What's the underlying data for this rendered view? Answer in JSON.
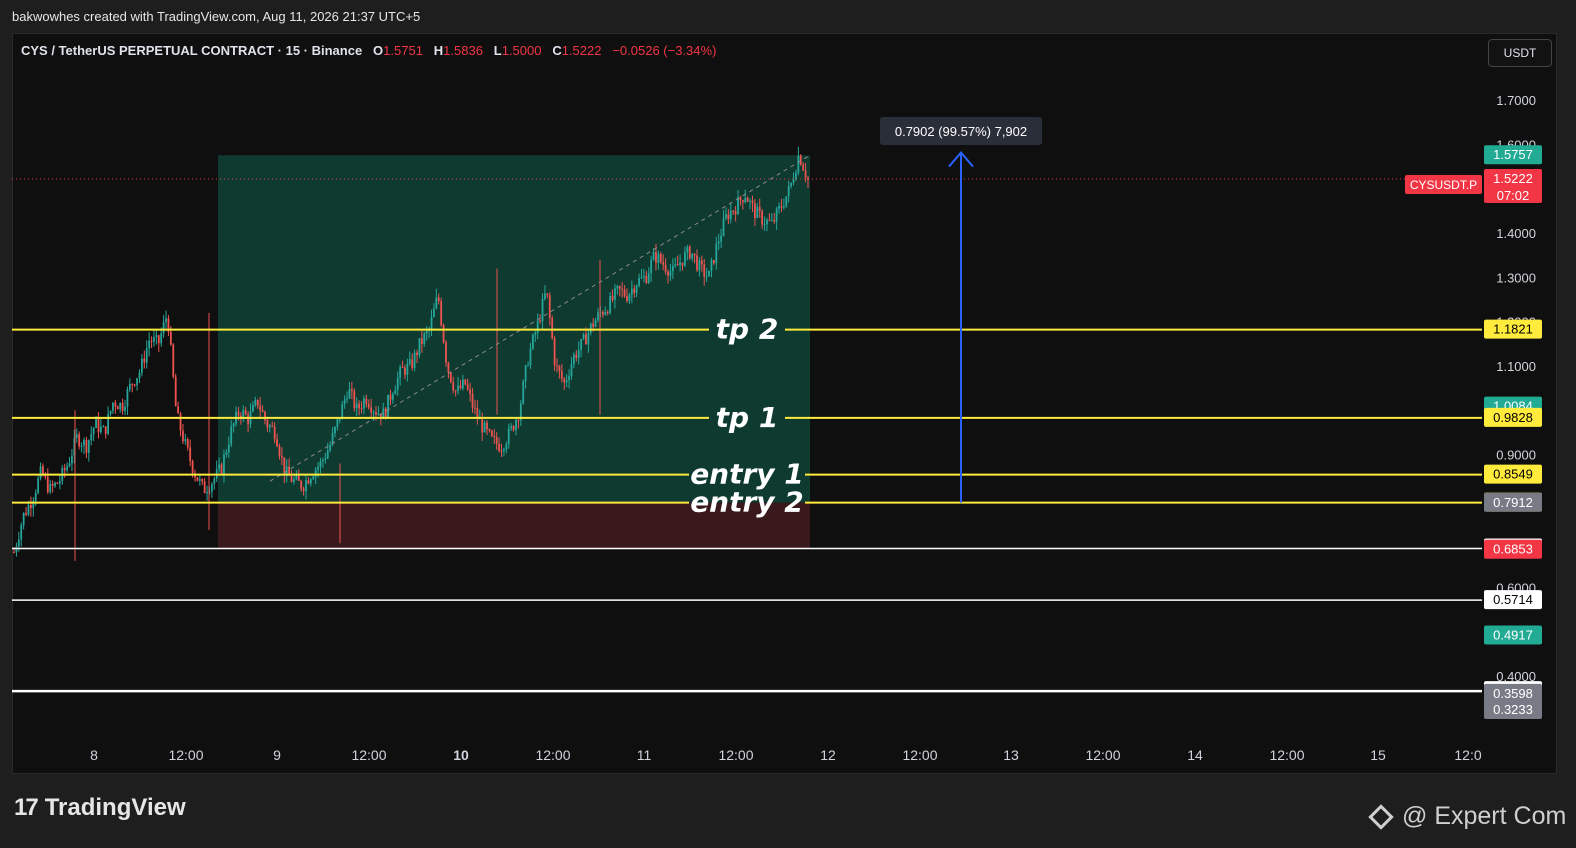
{
  "header": {
    "credit": "bakwowhes created with TradingView.com, Aug 11, 2026 21:37 UTC+5"
  },
  "legend": {
    "symbol": "CYS / TetherUS PERPETUAL CONTRACT · 15 · Binance",
    "o_label": "O",
    "o_value": "1.5751",
    "h_label": "H",
    "h_value": "1.5836",
    "l_label": "L",
    "l_value": "1.5000",
    "c_label": "C",
    "c_value": "1.5222",
    "change": "−0.0526 (−3.34%)"
  },
  "currency_button": "USDT",
  "symbol_tag": "CYSUSDT.P",
  "measure_label": "0.7902 (99.57%) 7,902",
  "branding": {
    "tradingview": "TradingView",
    "tv_mark": "17",
    "watermark": "@ Expert Com"
  },
  "colors": {
    "up": "#26a69a",
    "down": "#ef5350",
    "yellow_line": "#ffeb3b",
    "white_line": "#ffffff",
    "profit_zone": "#0f3d33",
    "loss_zone": "#3d1a1e",
    "arrow": "#2962ff",
    "last_price": "#f23645"
  },
  "chart_data": {
    "type": "candlestick",
    "title": "CYS / TetherUS PERPETUAL CONTRACT · 15 · Binance",
    "y_axis": {
      "ticks": [
        "1.7000",
        "1.6000",
        "1.4000",
        "1.3000",
        "1.2000",
        "1.1000",
        "0.9000",
        "0.6000",
        "0.4000"
      ],
      "range": [
        0.31,
        1.78
      ]
    },
    "x_axis": {
      "ticks": [
        "8",
        "12:00",
        "9",
        "12:00",
        "10",
        "12:00",
        "11",
        "12:00",
        "12",
        "12:00",
        "13",
        "12:00",
        "14",
        "12:00",
        "15",
        "12:0"
      ],
      "bold_ticks": [
        "10"
      ]
    },
    "price_path": [
      [
        0.68,
        0.76
      ],
      [
        0.8,
        0.86
      ],
      [
        0.82,
        0.84
      ],
      [
        0.88,
        0.94
      ],
      [
        0.92,
        0.97
      ],
      [
        0.95,
        1.02
      ],
      [
        1.01,
        1.06
      ],
      [
        1.09,
        1.16
      ],
      [
        1.15,
        1.22
      ],
      [
        0.99,
        0.92
      ],
      [
        0.86,
        0.82
      ],
      [
        0.84,
        0.87
      ],
      [
        0.95,
        1.0
      ],
      [
        0.98,
        1.02
      ],
      [
        0.97,
        0.95
      ],
      [
        0.86,
        0.84
      ],
      [
        0.83,
        0.86
      ],
      [
        0.88,
        0.92
      ],
      [
        0.98,
        1.05
      ],
      [
        1.0,
        1.03
      ],
      [
        1.0,
        0.99
      ],
      [
        1.05,
        1.09
      ],
      [
        1.1,
        1.15
      ],
      [
        1.18,
        1.26
      ],
      [
        1.1,
        1.04
      ],
      [
        1.06,
        1.0
      ],
      [
        0.96,
        0.93
      ],
      [
        0.92,
        0.95
      ],
      [
        1.0,
        1.12
      ],
      [
        1.19,
        1.27
      ],
      [
        1.1,
        1.06
      ],
      [
        1.12,
        1.15
      ],
      [
        1.19,
        1.22
      ],
      [
        1.24,
        1.27
      ],
      [
        1.26,
        1.29
      ],
      [
        1.3,
        1.35
      ],
      [
        1.33,
        1.31
      ],
      [
        1.34,
        1.36
      ],
      [
        1.32,
        1.3
      ],
      [
        1.38,
        1.44
      ],
      [
        1.46,
        1.49
      ],
      [
        1.45,
        1.43
      ],
      [
        1.42,
        1.46
      ],
      [
        1.5,
        1.58
      ],
      [
        1.52
      ]
    ],
    "levels": [
      {
        "label": "tp 2",
        "price": "1.1821",
        "kind": "target"
      },
      {
        "label": "tp 1",
        "price": "0.9828",
        "kind": "target"
      },
      {
        "label": "entry 1",
        "price": "0.8549",
        "kind": "entry"
      },
      {
        "label": "entry 2",
        "price": "0.7916",
        "kind": "entry"
      },
      {
        "label": "",
        "price": "0.6880",
        "kind": "support"
      },
      {
        "label": "",
        "price": "0.5714",
        "kind": "support"
      },
      {
        "label": "",
        "price": "0.3660",
        "kind": "support"
      }
    ],
    "position": {
      "entry": 0.7916,
      "target": 1.5757,
      "stop": 0.688
    },
    "measure": {
      "from": 0.7916,
      "to": 1.5818
    },
    "price_labels": [
      {
        "text": "1.5757",
        "price": 1.5757,
        "bg": "#22ab94",
        "fg": "#ffffff"
      },
      {
        "text": "1.5222",
        "price": 1.5222,
        "bg": "#f23645",
        "fg": "#ffffff",
        "sub": "07:02"
      },
      {
        "text": "1.1821",
        "price": 1.1821,
        "bg": "#ffeb3b",
        "fg": "#000000"
      },
      {
        "text": "1.0084",
        "price": 1.0084,
        "bg": "#22ab94",
        "fg": "#ffffff"
      },
      {
        "text": "0.9828",
        "price": 0.9828,
        "bg": "#ffeb3b",
        "fg": "#000000"
      },
      {
        "text": "0.8549",
        "price": 0.8549,
        "bg": "#ffeb3b",
        "fg": "#000000"
      },
      {
        "text": "0.7916",
        "price": 0.7916,
        "bg": "#ffeb3b",
        "fg": "#000000"
      },
      {
        "text": "0.7912",
        "price": 0.7912,
        "bg": "#787b86",
        "fg": "#ffffff"
      },
      {
        "text": "0.6880",
        "price": 0.688,
        "bg": "#ffffff",
        "fg": "#000000"
      },
      {
        "text": "0.6853",
        "price": 0.6853,
        "bg": "#f23645",
        "fg": "#ffffff"
      },
      {
        "text": "0.5714",
        "price": 0.5714,
        "bg": "#ffffff",
        "fg": "#000000"
      },
      {
        "text": "0.4917",
        "price": 0.4917,
        "bg": "#22ab94",
        "fg": "#ffffff"
      },
      {
        "text": "0.3660",
        "price": 0.366,
        "bg": "#ffffff",
        "fg": "#000000"
      },
      {
        "text": "0.3598",
        "price": 0.3598,
        "bg": "#787b86",
        "fg": "#ffffff"
      },
      {
        "text": "0.3233",
        "price": 0.3233,
        "bg": "#787b86",
        "fg": "#ffffff"
      }
    ]
  }
}
